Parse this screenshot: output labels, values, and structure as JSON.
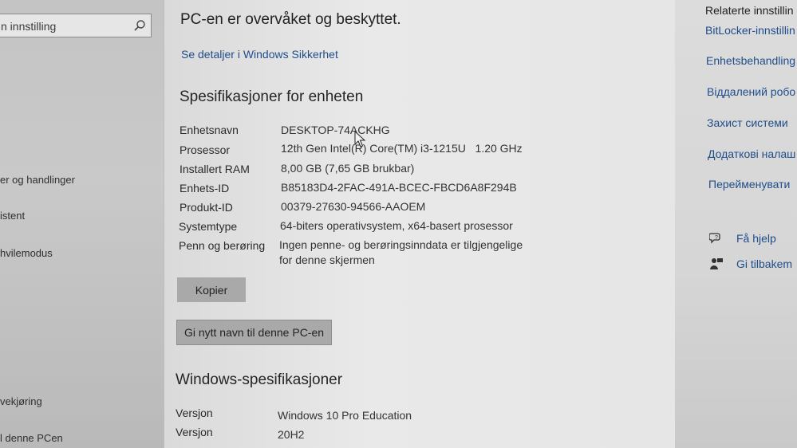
{
  "sidebar": {
    "search_placeholder": "n innstilling",
    "items": [
      "er og handlinger",
      "istent",
      " hvilemodus",
      "vekjøring",
      "l denne PCen"
    ]
  },
  "main": {
    "status_title": "PC-en er overvåket og beskyttet.",
    "security_link": "Se detaljer i Windows Sikkerhet",
    "device_specs": {
      "heading": "Spesifikasjoner for enheten",
      "rows": [
        {
          "label": "Enhetsnavn",
          "value": "DESKTOP-74ACKHG"
        },
        {
          "label": "Prosessor",
          "value": "12th Gen Intel(R) Core(TM) i3-1215U   1.20 GHz"
        },
        {
          "label": "Installert RAM",
          "value": "8,00 GB (7,65 GB brukbar)"
        },
        {
          "label": "Enhets-ID",
          "value": "B85183D4-2FAC-491A-BCEC-FBCD6A8F294B"
        },
        {
          "label": "Produkt-ID",
          "value": "00379-27630-94566-AAOEM"
        },
        {
          "label": "Systemtype",
          "value": "64-biters operativsystem, x64-basert prosessor"
        },
        {
          "label": "Penn og berøring",
          "value": "Ingen penne- og berøringsinndata er tilgjengelige",
          "value2": "for denne skjermen"
        }
      ],
      "copy_button": "Kopier",
      "rename_button": "Gi nytt navn til denne PC-en"
    },
    "windows_specs": {
      "heading": "Windows-spesifikasjoner",
      "rows": [
        {
          "label": "Versjon",
          "value": "Windows 10 Pro Education"
        },
        {
          "label": "Versjon",
          "value": "20H2"
        }
      ]
    }
  },
  "related": {
    "heading": "Relaterte innstillin",
    "links": [
      "BitLocker-innstillin",
      "Enhetsbehandling",
      "Віддалений робо",
      "Захист системи",
      "Додаткові налаш",
      "Перейменувати"
    ],
    "help": "Få hjelp",
    "feedback": "Gi tilbakem"
  },
  "colors": {
    "accent_link": "#1f4d8a",
    "button_bg": "#a9a9a9"
  }
}
